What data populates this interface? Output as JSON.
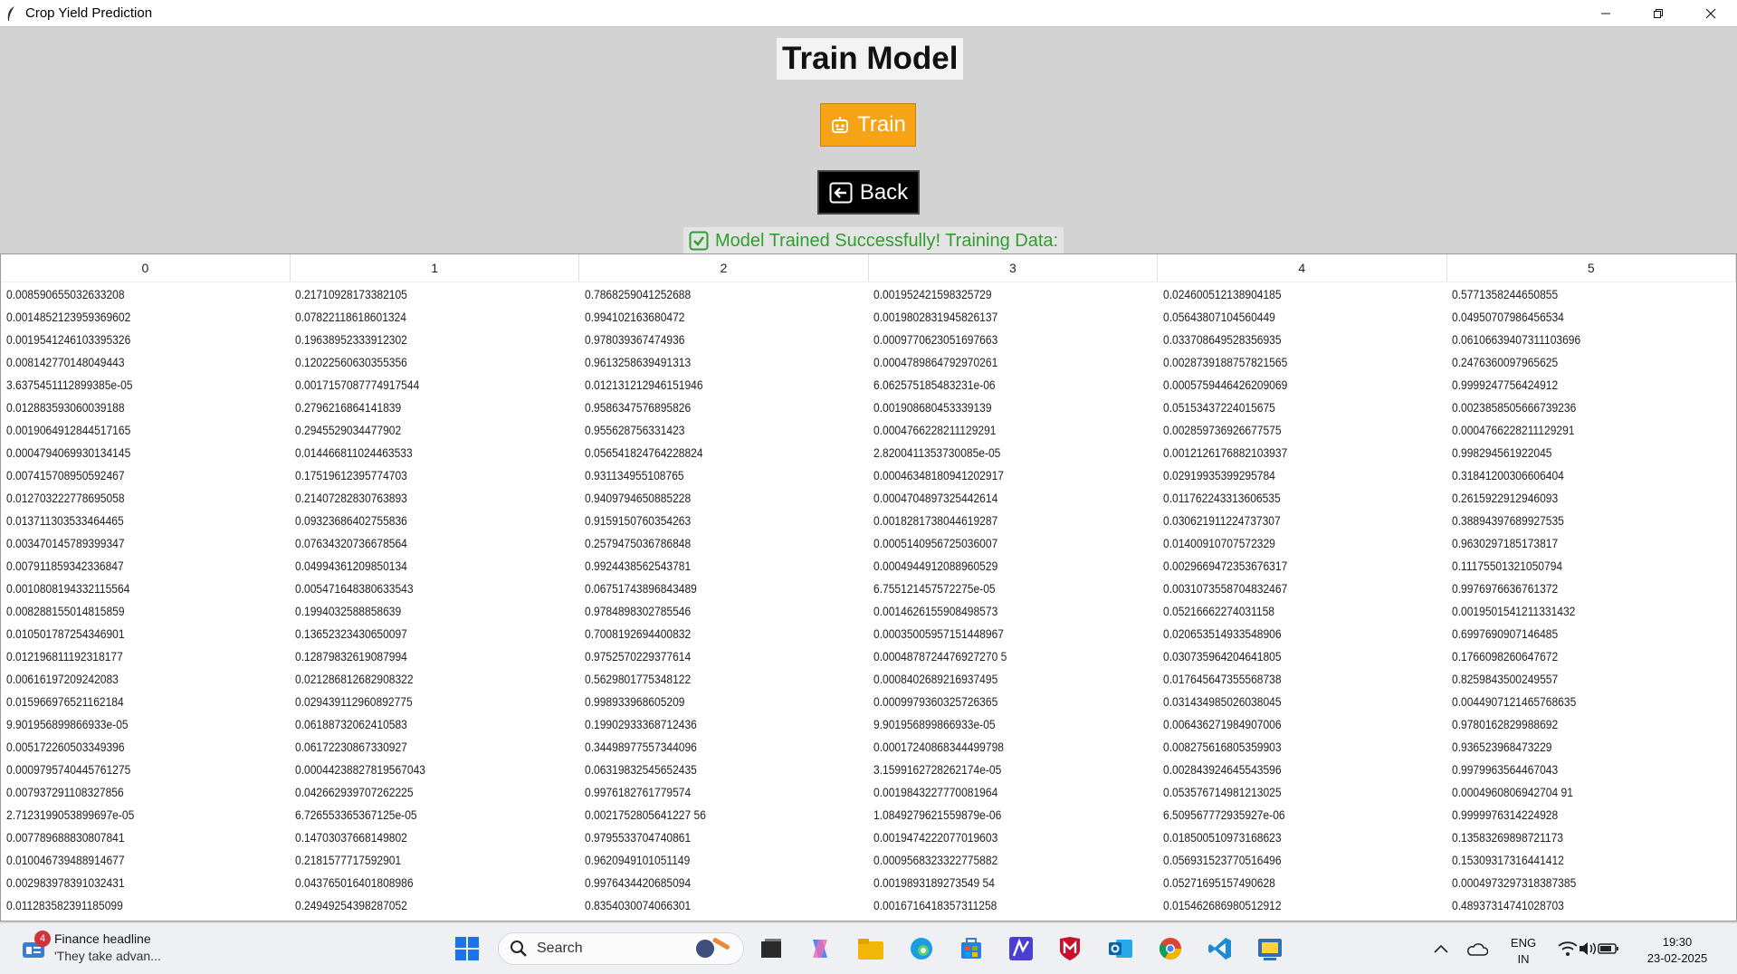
{
  "window": {
    "title": "Crop Yield Prediction"
  },
  "page": {
    "heading": "Train Model",
    "train_label": "Train",
    "back_label": "Back",
    "status": "Model Trained Successfully! Training Data:"
  },
  "table": {
    "columns": [
      "0",
      "1",
      "2",
      "3",
      "4",
      "5"
    ],
    "rows": [
      [
        "0.008590655032633208",
        "0.21710928173382105",
        "0.7868259041252688",
        "0.001952421598325729",
        "0.024600512138904185",
        "0.5771358244650855"
      ],
      [
        "0.0014852123959369602",
        "0.07822118618601324",
        "0.994102163680472",
        "0.0019802831945826137",
        "0.05643807104560449",
        "0.04950707986456534"
      ],
      [
        "0.0019541246103395326",
        "0.19638952333912302",
        "0.978039367474936",
        "0.0009770623051697663",
        "0.033708649528356935",
        "0.06106639407311103696"
      ],
      [
        "0.008142770148049443",
        "0.12022560630355356",
        "0.9613258639491313",
        "0.0004789864792970261",
        "0.0028739188757821565",
        "0.2476360097965625"
      ],
      [
        "3.6375451112899385e-05",
        "0.0017157087774917544",
        "0.012131212946151946",
        "6.062575185483231e-06",
        "0.0005759446426209069",
        "0.9999247756424912"
      ],
      [
        "0.012883593060039188",
        "0.2796216864141839",
        "0.9586347576895826",
        "0.001908680453339139",
        "0.05153437224015675",
        "0.0023858505666739236"
      ],
      [
        "0.0019064912844517165",
        "0.2945529034477902",
        "0.955628756331423",
        "0.0004766228211129291",
        "0.002859736926677575",
        "0.0004766228211129291"
      ],
      [
        "0.0004794069930134145",
        "0.014466811024463533",
        "0.056541824764228824",
        "2.8200411353730085e-05",
        "0.0012126176882103937",
        "0.998294561922045"
      ],
      [
        "0.007415708950592467",
        "0.17519612395774703",
        "0.931134955108765",
        "0.00046348180941202917",
        "0.02919935399295784",
        "0.31841200306606404"
      ],
      [
        "0.012703222778695058",
        "0.21407282830763893",
        "0.9409794650885228",
        "0.0004704897325442614",
        "0.011762243313606535",
        "0.2615922912946093"
      ],
      [
        "0.013711303533464465",
        "0.09323686402755836",
        "0.9159150760354263",
        "0.0018281738044619287",
        "0.030621911224737307",
        "0.38894397689927535"
      ],
      [
        "0.003470145789399347",
        "0.07634320736678564",
        "0.2579475036786848",
        "0.0005140956725036007",
        "0.01400910707572329",
        "0.9630297185173817"
      ],
      [
        "0.007911859342336847",
        "0.04994361209850134",
        "0.9924438562543781",
        "0.0004944912088960529",
        "0.0029669472353676317",
        "0.11175501321050794"
      ],
      [
        "0.0010808194332115564",
        "0.005471648380633543",
        "0.06751743896843489",
        "6.755121457572275e-05",
        "0.0031073558704832467",
        "0.9976976636761372"
      ],
      [
        "0.008288155014815859",
        "0.1994032588858639",
        "0.9784898302785546",
        "0.0014626155908498573",
        "0.05216662274031158",
        "0.0019501541211331432"
      ],
      [
        "0.010501787254346901",
        "0.13652323430650097",
        "0.7008192694400832",
        "0.00035005957151448967",
        "0.020653514933548906",
        "0.6997690907146485"
      ],
      [
        "0.012196811192318177",
        "0.12879832619087994",
        "0.9752570229377614",
        "0.0004878724476927270 5",
        "0.030735964204641805",
        "0.1766098260647672"
      ],
      [
        "0.00616197209242083",
        "0.021286812682908322",
        "0.5629801775348122",
        "0.0008402689216937495",
        "0.017645647355568738",
        "0.8259843500249557"
      ],
      [
        "0.015966976521162184",
        "0.029439112960892775",
        "0.998933968605209",
        "0.0009979360325726365",
        "0.031434985026038045",
        "0.0044907121465768635"
      ],
      [
        "9.901956899866933e-05",
        "0.06188732062410583",
        "0.19902933368712436",
        "9.901956899866933e-05",
        "0.006436271984907006",
        "0.9780162829988692"
      ],
      [
        "0.005172260503349396",
        "0.06172230867330927",
        "0.34498977557344096",
        "0.00017240868344499798",
        "0.008275616805359903",
        "0.936523968473229"
      ],
      [
        "0.0009795740445761275",
        "0.00044238827819567043",
        "0.06319832545652435",
        "3.1599162728262174e-05",
        "0.002843924645543596",
        "0.9979963564467043"
      ],
      [
        "0.007937291108327856",
        "0.042662939707262225",
        "0.9976182761779574",
        "0.0019843227770081964",
        "0.053576714981213025",
        "0.0004960806942704 91"
      ],
      [
        "2.7123199053899697e-05",
        "6.726553365367125e-05",
        "0.0021752805641227 56",
        "1.0849279621559879e-06",
        "6.509567772935927e-06",
        "0.9999976314224928"
      ],
      [
        "0.007789688830807841",
        "0.14703037668149802",
        "0.9795533704740861",
        "0.0019474222077019603",
        "0.018500510973168623",
        "0.13583269898721173"
      ],
      [
        "0.010046739488914677",
        "0.2181577717592901",
        "0.9620949101051149",
        "0.0009568323322775882",
        "0.056931523770516496",
        "0.15309317316441412"
      ],
      [
        "0.002983978391032431",
        "0.043765016401808986",
        "0.9976434420685094",
        "0.0019893189273549 54",
        "0.05271695157490628",
        "0.0004973297318387385"
      ],
      [
        "0.011283582391185099",
        "0.24949254398287052",
        "0.8354030074066301",
        "0.0016716418357311258",
        "0.015462686980512912",
        "0.48937314741028703"
      ]
    ]
  },
  "taskbar": {
    "news_badge": "4",
    "news_title": "Finance headline",
    "news_sub": "'They take advan...",
    "search_placeholder": "Search",
    "lang_top": "ENG",
    "lang_bottom": "IN",
    "time": "19:30",
    "date": "23-02-2025"
  },
  "colors": {
    "accent_orange": "#f6a316",
    "success_green": "#2e9e2e"
  }
}
